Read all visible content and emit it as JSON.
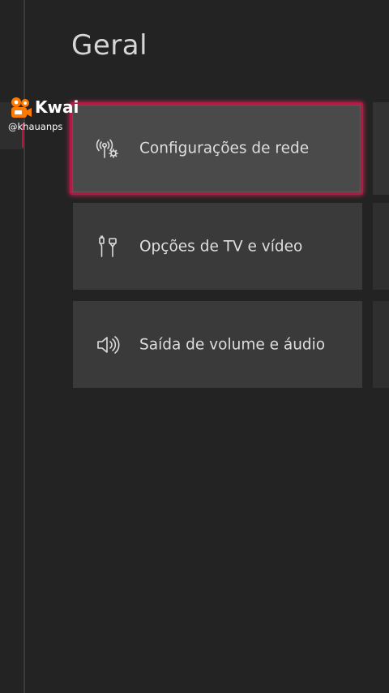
{
  "page": {
    "title": "Geral"
  },
  "menu": {
    "items": [
      {
        "label": "Configurações de rede",
        "icon": "network-settings-icon",
        "focused": true
      },
      {
        "label": "Opções de TV e vídeo",
        "icon": "hdmi-cable-icon",
        "focused": false
      },
      {
        "label": "Saída de volume e áudio",
        "icon": "speaker-volume-icon",
        "focused": false
      }
    ]
  },
  "watermark": {
    "brand": "Kwai",
    "handle": "@khauanps",
    "icon": "kwai-logo-icon"
  },
  "colors": {
    "background": "#232323",
    "tile": "#3a3a3a",
    "tile_focused": "#4a4a4a",
    "focus_border": "#b11a45",
    "brand_orange": "#ff7a00"
  }
}
